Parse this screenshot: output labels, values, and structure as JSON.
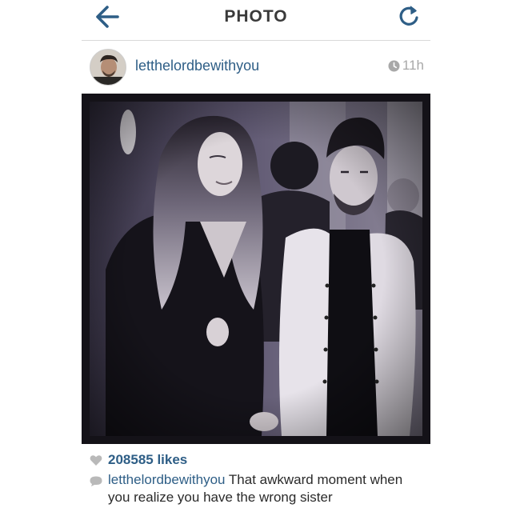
{
  "navbar": {
    "title": "PHOTO",
    "back_icon": "back-arrow-icon",
    "refresh_icon": "refresh-icon",
    "accent_color": "#2e5e86"
  },
  "post": {
    "username": "letthelordbewithyou",
    "time_ago": "11h",
    "time_icon": "clock-icon",
    "photo_description_icon": "photo-image"
  },
  "footer": {
    "likes": "208585 likes",
    "like_icon": "heart-icon",
    "comment_icon": "comment-bubble-icon",
    "caption_user": "letthelordbewithyou",
    "caption_text": " That awkward moment when you realize you have the wrong sister"
  }
}
